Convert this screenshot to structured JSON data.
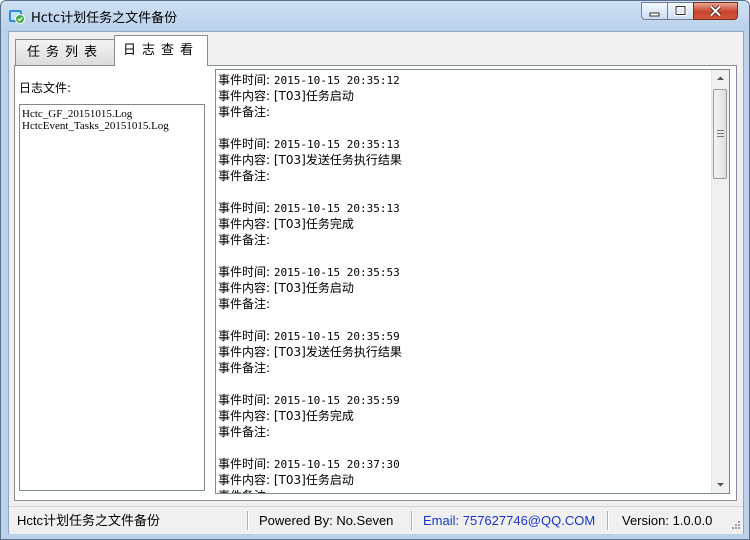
{
  "window": {
    "title": "Hctc计划任务之文件备份",
    "icon": "app-icon"
  },
  "tabs": [
    {
      "label": "任务列表",
      "active": false
    },
    {
      "label": "日志查看",
      "active": true
    }
  ],
  "log_files": {
    "label": "日志文件:",
    "items": [
      "Hctc_GF_20151015.Log",
      "HctcEvent_Tasks_20151015.Log"
    ]
  },
  "log": {
    "time_label": "事件时间:",
    "content_label": "事件内容:",
    "note_label": "事件备注:",
    "entries": [
      {
        "time": "2015-10-15 20:35:12",
        "content": "[T03]任务启动",
        "note": ""
      },
      {
        "time": "2015-10-15 20:35:13",
        "content": "[T03]发送任务执行结果",
        "note": ""
      },
      {
        "time": "2015-10-15 20:35:13",
        "content": "[T03]任务完成",
        "note": ""
      },
      {
        "time": "2015-10-15 20:35:53",
        "content": "[T03]任务启动",
        "note": ""
      },
      {
        "time": "2015-10-15 20:35:59",
        "content": "[T03]发送任务执行结果",
        "note": ""
      },
      {
        "time": "2015-10-15 20:35:59",
        "content": "[T03]任务完成",
        "note": ""
      },
      {
        "time": "2015-10-15 20:37:30",
        "content": "[T03]任务启动",
        "note": ""
      }
    ]
  },
  "status": {
    "app": "Hctc计划任务之文件备份",
    "powered": "Powered By: No.Seven",
    "email": "Email: 757627746@QQ.COM",
    "version": "Version: 1.0.0.0",
    "email_color": "#1a35c4"
  }
}
